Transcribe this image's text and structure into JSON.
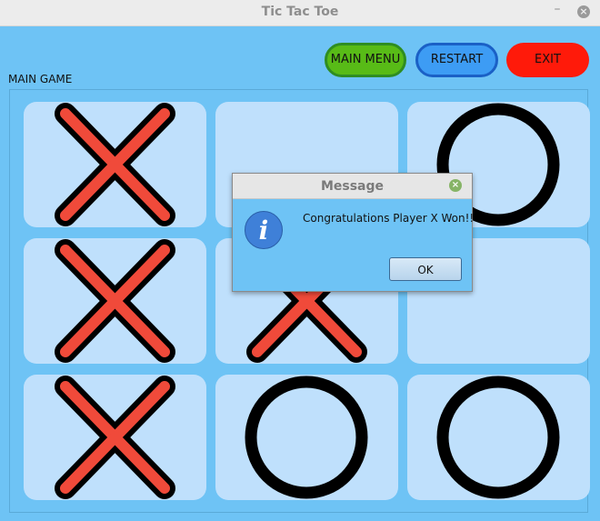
{
  "window": {
    "title": "Tic Tac Toe"
  },
  "toolbar": {
    "main_menu": "MAIN MENU",
    "restart": "RESTART",
    "exit": "EXIT"
  },
  "section_label": "MAIN GAME",
  "board": {
    "cells": [
      "X",
      "",
      "O",
      "X",
      "X",
      "",
      "X",
      "O",
      "O"
    ]
  },
  "dialog": {
    "title": "Message",
    "message": "Congratulations Player X Won!!",
    "ok": "OK",
    "icon": "info-icon"
  },
  "colors": {
    "background": "#6ec3f5",
    "cell": "#bfe0fc",
    "x_fill": "#f04a3a",
    "main_menu": "#58bb17",
    "restart": "#3d9cf4",
    "exit": "#ff1a0a"
  }
}
